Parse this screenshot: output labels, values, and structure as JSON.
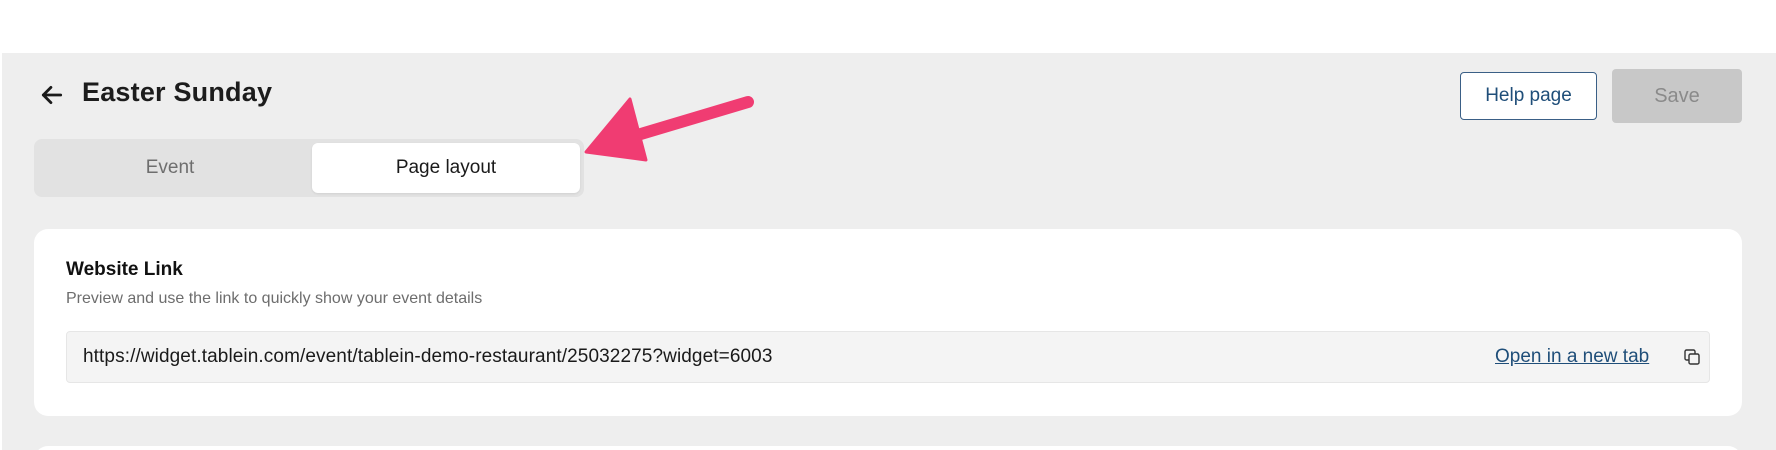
{
  "header": {
    "title": "Easter Sunday",
    "help_label": "Help page",
    "save_label": "Save"
  },
  "tabs": [
    {
      "label": "Event",
      "active": false
    },
    {
      "label": "Page layout",
      "active": true
    }
  ],
  "website_link": {
    "title": "Website Link",
    "subtitle": "Preview and use the link to quickly show your event details",
    "url": "https://widget.tablein.com/event/tablein-demo-restaurant/25032275?widget=6003",
    "open_label": "Open in a new tab"
  },
  "icons": {
    "back": "arrow-left-icon",
    "copy": "copy-icon",
    "annotation": "annotation-arrow"
  },
  "colors": {
    "accent": "#1f4e79",
    "annotation": "#f03c72",
    "page_bg": "#eeeeee",
    "save_disabled_bg": "#c8c8c8"
  }
}
